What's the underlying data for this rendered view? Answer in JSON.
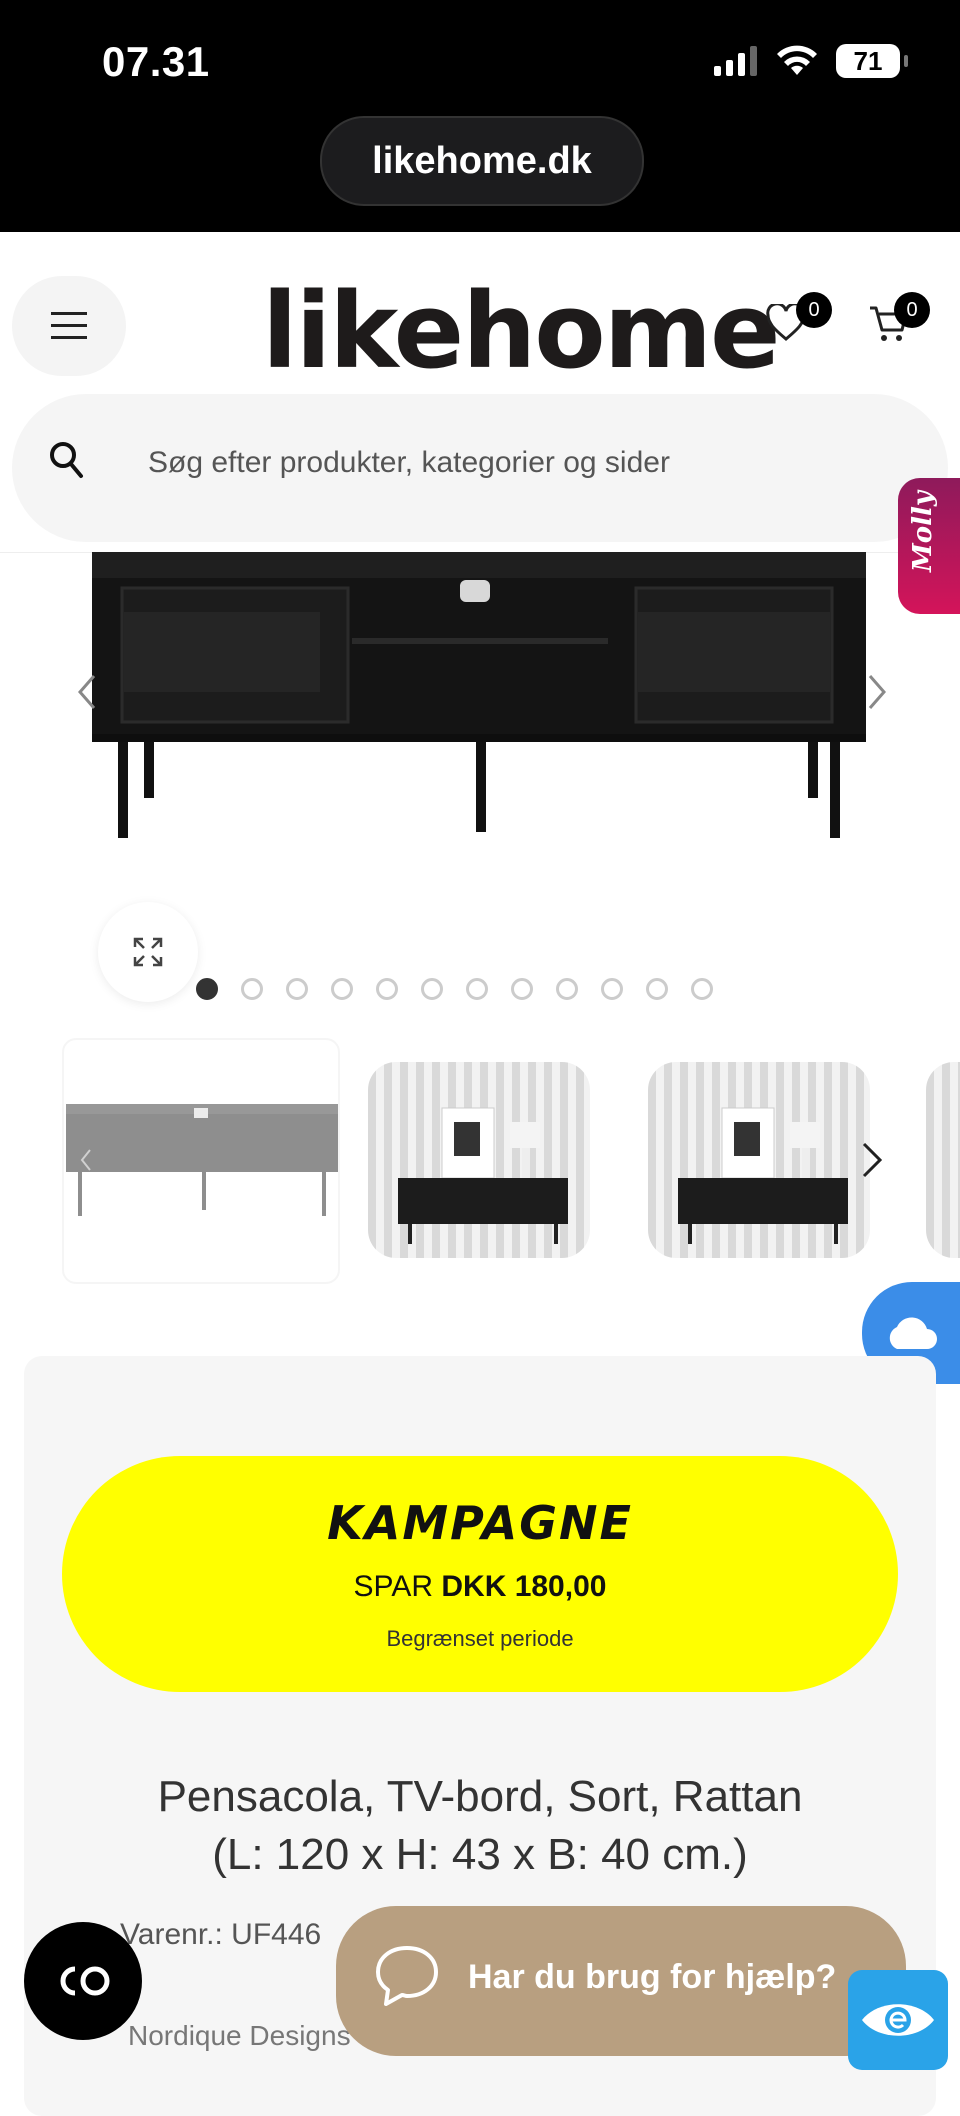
{
  "status_bar": {
    "time": "07.31",
    "battery": "71"
  },
  "browser": {
    "url": "likehome.dk"
  },
  "header": {
    "logo": "likehome",
    "wishlist_count": "0",
    "cart_count": "0"
  },
  "search": {
    "placeholder": "Søg efter produkter, kategorier og sider"
  },
  "chat_widget": {
    "label": "Molly"
  },
  "gallery": {
    "dots_total": 12,
    "active_index": 0
  },
  "campaign": {
    "title": "KAMPAGNE",
    "save_prefix": "SPAR",
    "save_amount": "DKK 180,00",
    "period": "Begrænset periode"
  },
  "product": {
    "title_line1": "Pensacola, TV-bord, Sort, Rattan",
    "title_line2": "(L: 120 x H: 43 x B: 40 cm.)",
    "sku": "Varenr.: UF446",
    "brand": "Nordique Designs"
  },
  "help": {
    "label": "Har du brug for hjælp?"
  },
  "colors": {
    "campaign_bg": "#ffff00",
    "help_bg": "#b89f80",
    "molly_accent": "#d4145a",
    "cloud": "#3b8de8"
  }
}
